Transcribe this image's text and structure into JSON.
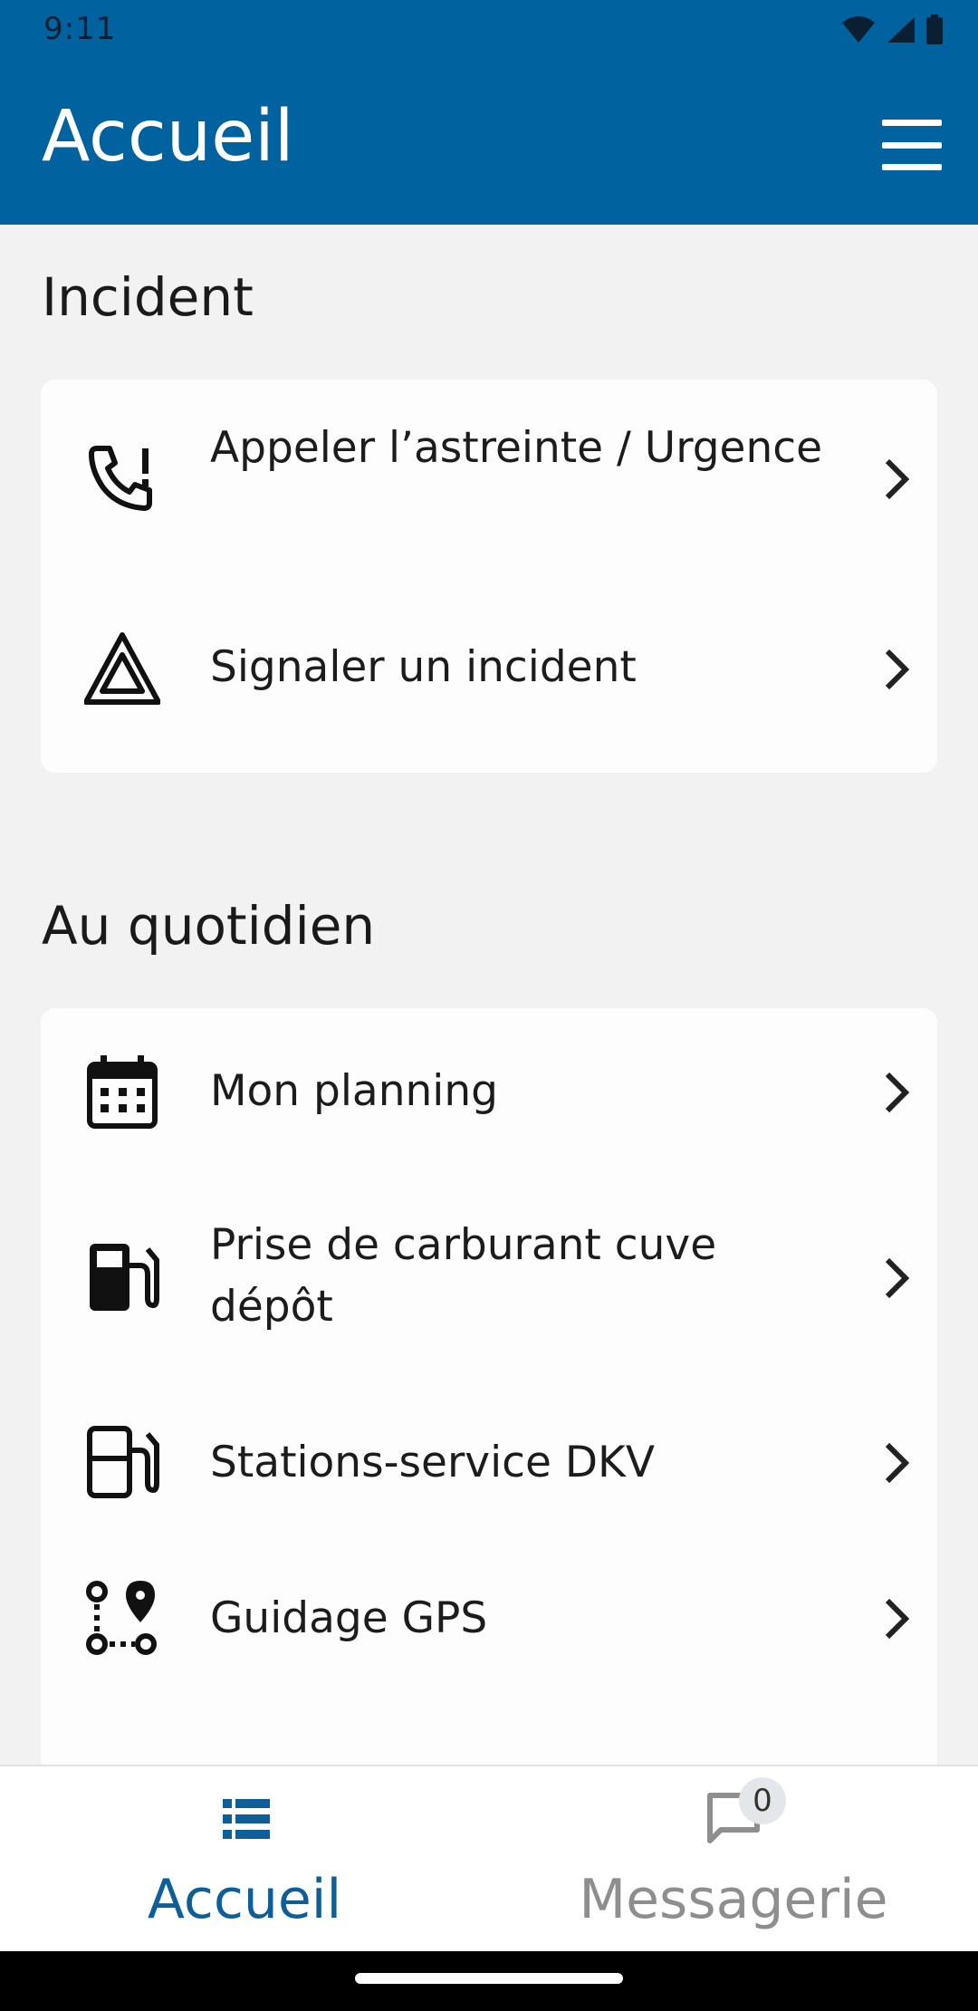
{
  "status": {
    "time": "9:11"
  },
  "appbar": {
    "title": "Accueil"
  },
  "sections": {
    "incident": {
      "title": "Incident",
      "items": [
        {
          "label": "Appeler l’astreinte / Urgence",
          "icon": "phone-alert-icon"
        },
        {
          "label": "Signaler un incident",
          "icon": "warning-triangle-icon"
        }
      ]
    },
    "daily": {
      "title": "Au quotidien",
      "items": [
        {
          "label": "Mon planning",
          "icon": "calendar-icon"
        },
        {
          "label": "Prise de carburant cuve dépôt",
          "icon": "fuel-pump-icon"
        },
        {
          "label": "Stations-service DKV",
          "icon": "fuel-station-outline-icon"
        },
        {
          "label": "Guidage GPS",
          "icon": "route-icon"
        }
      ]
    }
  },
  "bottomnav": {
    "home": {
      "label": "Accueil",
      "icon": "list-icon"
    },
    "messages": {
      "label": "Messagerie",
      "icon": "chat-icon",
      "badge": "0"
    }
  },
  "colors": {
    "primary": "#00629f",
    "nav_active": "#0e5f98",
    "nav_inactive": "#8e8e8e",
    "background": "#f2f2f2"
  }
}
